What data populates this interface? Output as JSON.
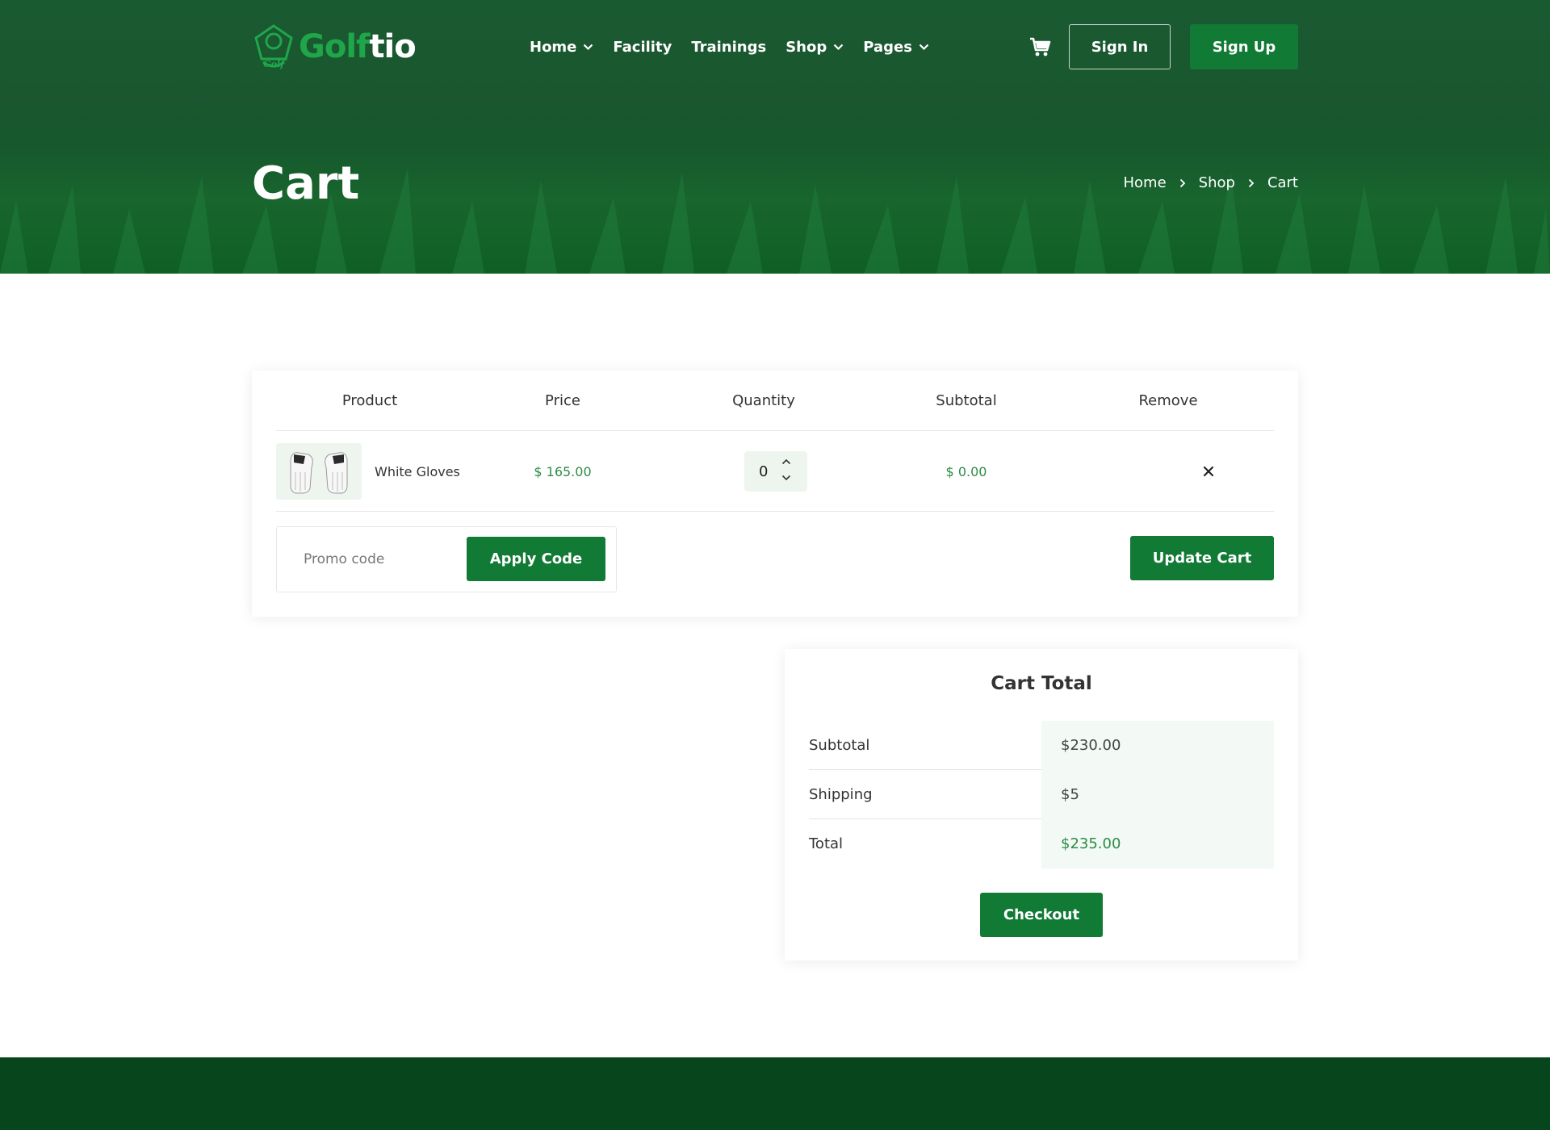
{
  "brand": {
    "name_part1": "Golf",
    "name_part2": "tio",
    "icon": "golf-logo-icon"
  },
  "nav": {
    "items": [
      {
        "label": "Home",
        "has_dropdown": true
      },
      {
        "label": "Facility",
        "has_dropdown": false
      },
      {
        "label": "Trainings",
        "has_dropdown": false
      },
      {
        "label": "Shop",
        "has_dropdown": true
      },
      {
        "label": "Pages",
        "has_dropdown": true
      }
    ],
    "cart_icon": "cart-icon",
    "signin_label": "Sign In",
    "signup_label": "Sign Up"
  },
  "hero": {
    "title": "Cart",
    "breadcrumb": [
      "Home",
      "Shop",
      "Cart"
    ]
  },
  "cart": {
    "columns": [
      "Product",
      "Price",
      "Quantity",
      "Subtotal",
      "Remove"
    ],
    "rows": [
      {
        "product": "White Gloves",
        "price": "$ 165.00",
        "quantity": "0",
        "subtotal": "$ 0.00"
      }
    ],
    "promo_placeholder": "Promo code",
    "apply_label": "Apply Code",
    "update_label": "Update Cart"
  },
  "totals": {
    "title": "Cart Total",
    "rows": [
      {
        "label": "Subtotal",
        "value": "$230.00"
      },
      {
        "label": "Shipping",
        "value": "$5"
      },
      {
        "label": "Total",
        "value": "$235.00"
      }
    ],
    "checkout_label": "Checkout"
  },
  "colors": {
    "brand_green": "#117a34",
    "price_green": "#2c8c46",
    "hero_green": "#1a5a31",
    "footer_green": "#07461c"
  }
}
